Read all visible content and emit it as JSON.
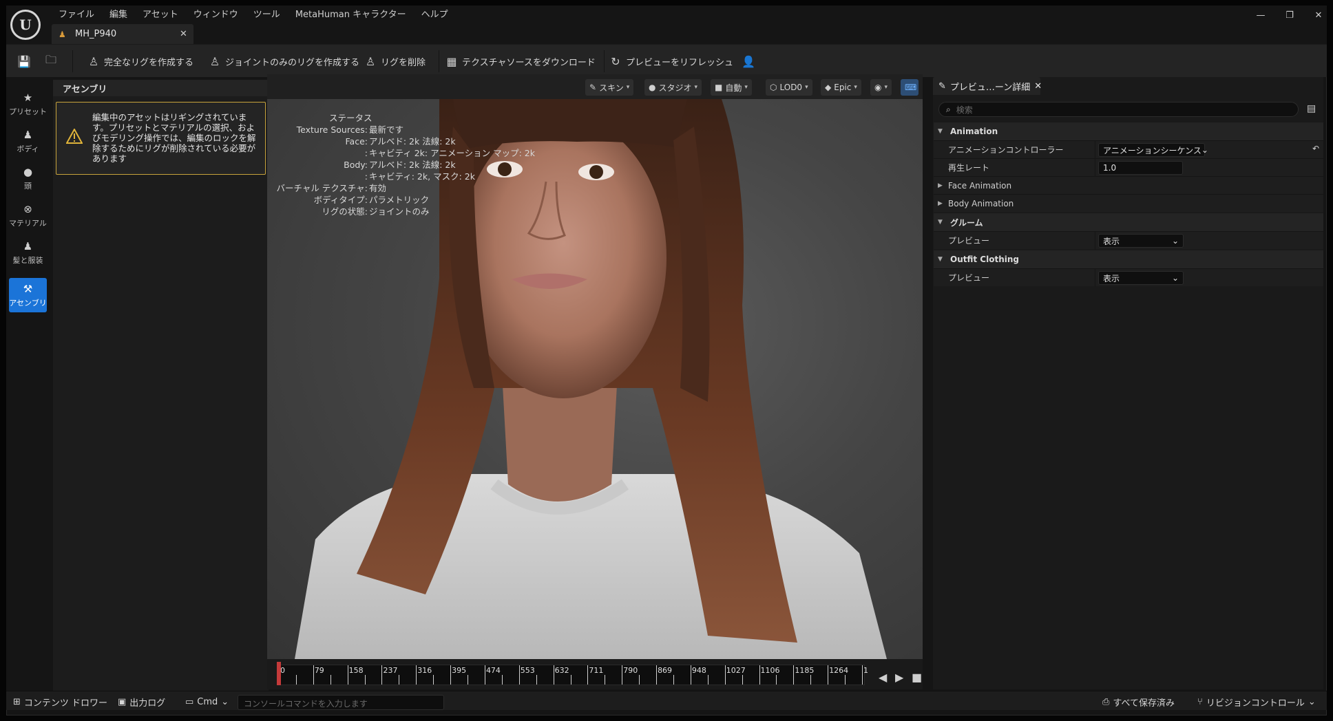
{
  "app": {
    "menu": [
      "ファイル",
      "編集",
      "アセット",
      "ウィンドウ",
      "ツール",
      "MetaHuman キャラクター",
      "ヘルプ"
    ],
    "doc_tab": "MH_P940"
  },
  "toolbar": {
    "create_full_rig": "完全なリグを作成する",
    "create_joint_rig": "ジョイントのみのリグを作成する",
    "remove_rig": "リグを削除",
    "download_textures": "テクスチャソースをダウンロード",
    "refresh_preview": "プレビューをリフレッシュ"
  },
  "leftnav": {
    "items": [
      {
        "label": "プリセット",
        "icon": "star-icon"
      },
      {
        "label": "ボディ",
        "icon": "body-icon"
      },
      {
        "label": "頭",
        "icon": "head-icon"
      },
      {
        "label": "マテリアル",
        "icon": "material-icon"
      },
      {
        "label": "髪と服装",
        "icon": "hair-clothing-icon"
      },
      {
        "label": "アセンブリ",
        "icon": "hammer-icon",
        "active": true
      }
    ]
  },
  "assembly": {
    "header": "アセンブリ",
    "warning": "編集中のアセットはリギングされています。プリセットとマテリアルの選択、およびモデリング操作では、編集のロックを解除するためにリグが削除されている必要があります"
  },
  "viewport": {
    "toolbar": {
      "skin": "スキン",
      "studio": "スタジオ",
      "auto": "自動",
      "lod": "LOD0",
      "quality": "Epic"
    },
    "stats": {
      "title": "ステータス",
      "rows": [
        {
          "k": "Texture Sources:",
          "v": "最新です"
        },
        {
          "k": "Face:",
          "v": "アルベド: 2k 法線: 2k"
        },
        {
          "k": ":",
          "v": "キャビティ 2k: アニメーション マップ: 2k"
        },
        {
          "k": "Body:",
          "v": "アルベド: 2k 法線: 2k"
        },
        {
          "k": ":",
          "v": "キャビティ: 2k, マスク: 2k"
        },
        {
          "k": "バーチャル テクスチャ:",
          "v": "有効"
        },
        {
          "k": "ボディタイプ:",
          "v": "パラメトリック"
        },
        {
          "k": "リグの状態:",
          "v": "ジョイントのみ"
        }
      ]
    }
  },
  "timeline": {
    "labels": [
      "0",
      "79",
      "158",
      "237",
      "316",
      "395",
      "474",
      "553",
      "632",
      "711",
      "790",
      "869",
      "948",
      "1027",
      "1106",
      "1185",
      "1264",
      "1"
    ]
  },
  "details": {
    "tab": "プレビュ…ーン詳細",
    "search_placeholder": "検索",
    "animation": {
      "header": "Animation",
      "controller_label": "アニメーションコントローラー",
      "controller_value": "アニメーションシーケンス",
      "rate_label": "再生レート",
      "rate_value": "1.0",
      "face_animation": "Face Animation",
      "body_animation": "Body Animation"
    },
    "groom": {
      "header": "グルーム",
      "preview_label": "プレビュー",
      "preview_value": "表示"
    },
    "outfit": {
      "header": "Outfit Clothing",
      "preview_label": "プレビュー",
      "preview_value": "表示"
    }
  },
  "statusbar": {
    "content_drawer": "コンテンツ ドロワー",
    "output_log": "出力ログ",
    "cmd": "Cmd",
    "console_placeholder": "コンソールコマンドを入力します",
    "save_all": "すべて保存済み",
    "revision_control": "リビジョンコントロール"
  }
}
